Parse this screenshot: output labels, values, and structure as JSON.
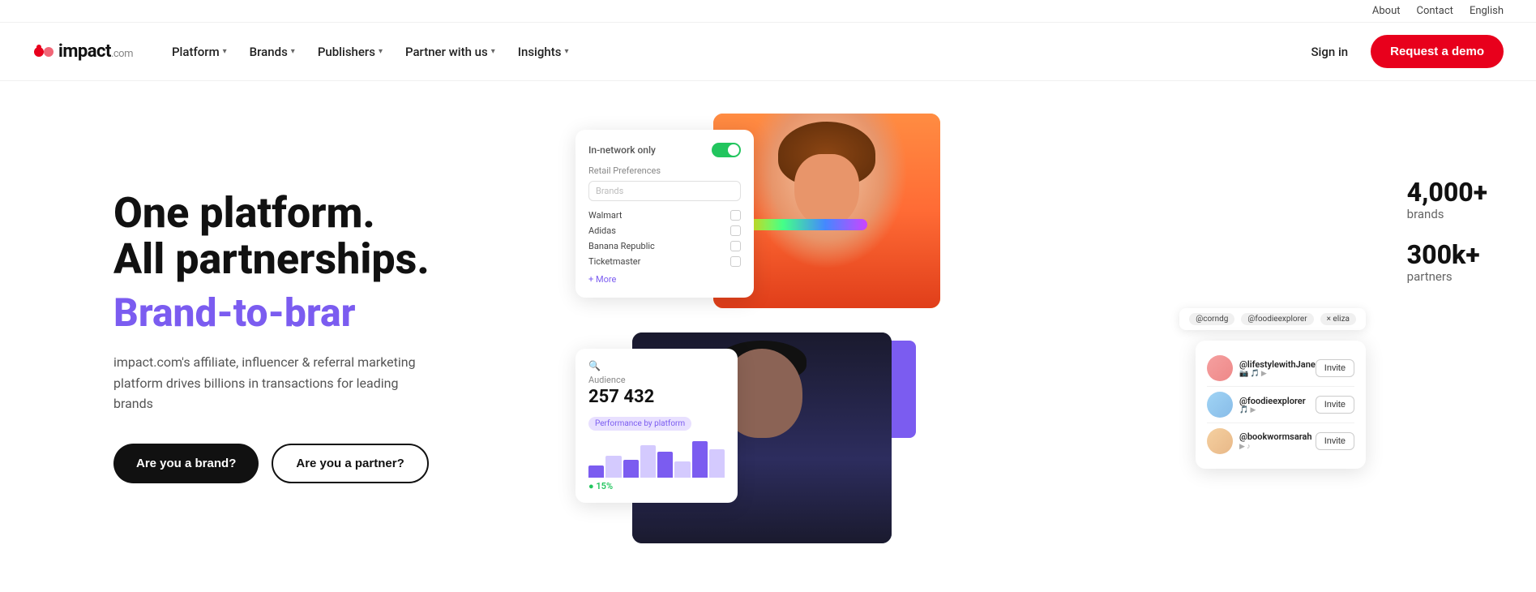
{
  "topbar": {
    "about": "About",
    "contact": "Contact",
    "language": "English"
  },
  "navbar": {
    "logo_main": "impact",
    "logo_sub": ".com",
    "platform": "Platform",
    "brands": "Brands",
    "publishers": "Publishers",
    "partner_with_us": "Partner with us",
    "insights": "Insights",
    "sign_in": "Sign in",
    "request_demo": "Request a demo"
  },
  "hero": {
    "title_line1": "One platform.",
    "title_line2": "All partnerships.",
    "subtitle_animated": "Brand-to-brar",
    "description": "impact.com's affiliate, influencer & referral marketing platform drives billions in transactions for leading brands",
    "btn_brand": "Are you a brand?",
    "btn_partner": "Are you a partner?"
  },
  "stats": {
    "brands_number": "4,000+",
    "brands_label": "brands",
    "partners_number": "300k+",
    "partners_label": "partners"
  },
  "card_retail": {
    "header": "In-network only",
    "section": "Retail Preferences",
    "placeholder": "Brands",
    "rows": [
      "Walmart",
      "Adidas",
      "Banana Republic",
      "Ticketmaster"
    ],
    "more": "+ More"
  },
  "card_analytics": {
    "audience_label": "Audience",
    "audience_number": "257 432",
    "perf_label": "Performance by platform",
    "percent": "● 15%"
  },
  "card_social": {
    "users": [
      {
        "name": "@lifestylewithJane",
        "icons": "📷 🎵 ▶",
        "action": "Invite"
      },
      {
        "name": "@foodieexplorer",
        "icons": "🎵 ▶",
        "action": "Invite"
      },
      {
        "name": "@bookwormsarah",
        "icons": "▶ ♪",
        "action": "Invite"
      }
    ]
  },
  "top_social_bar": {
    "handle1": "@corndg",
    "handle2": "@foodieexplorer",
    "handle3": "× eliza"
  }
}
